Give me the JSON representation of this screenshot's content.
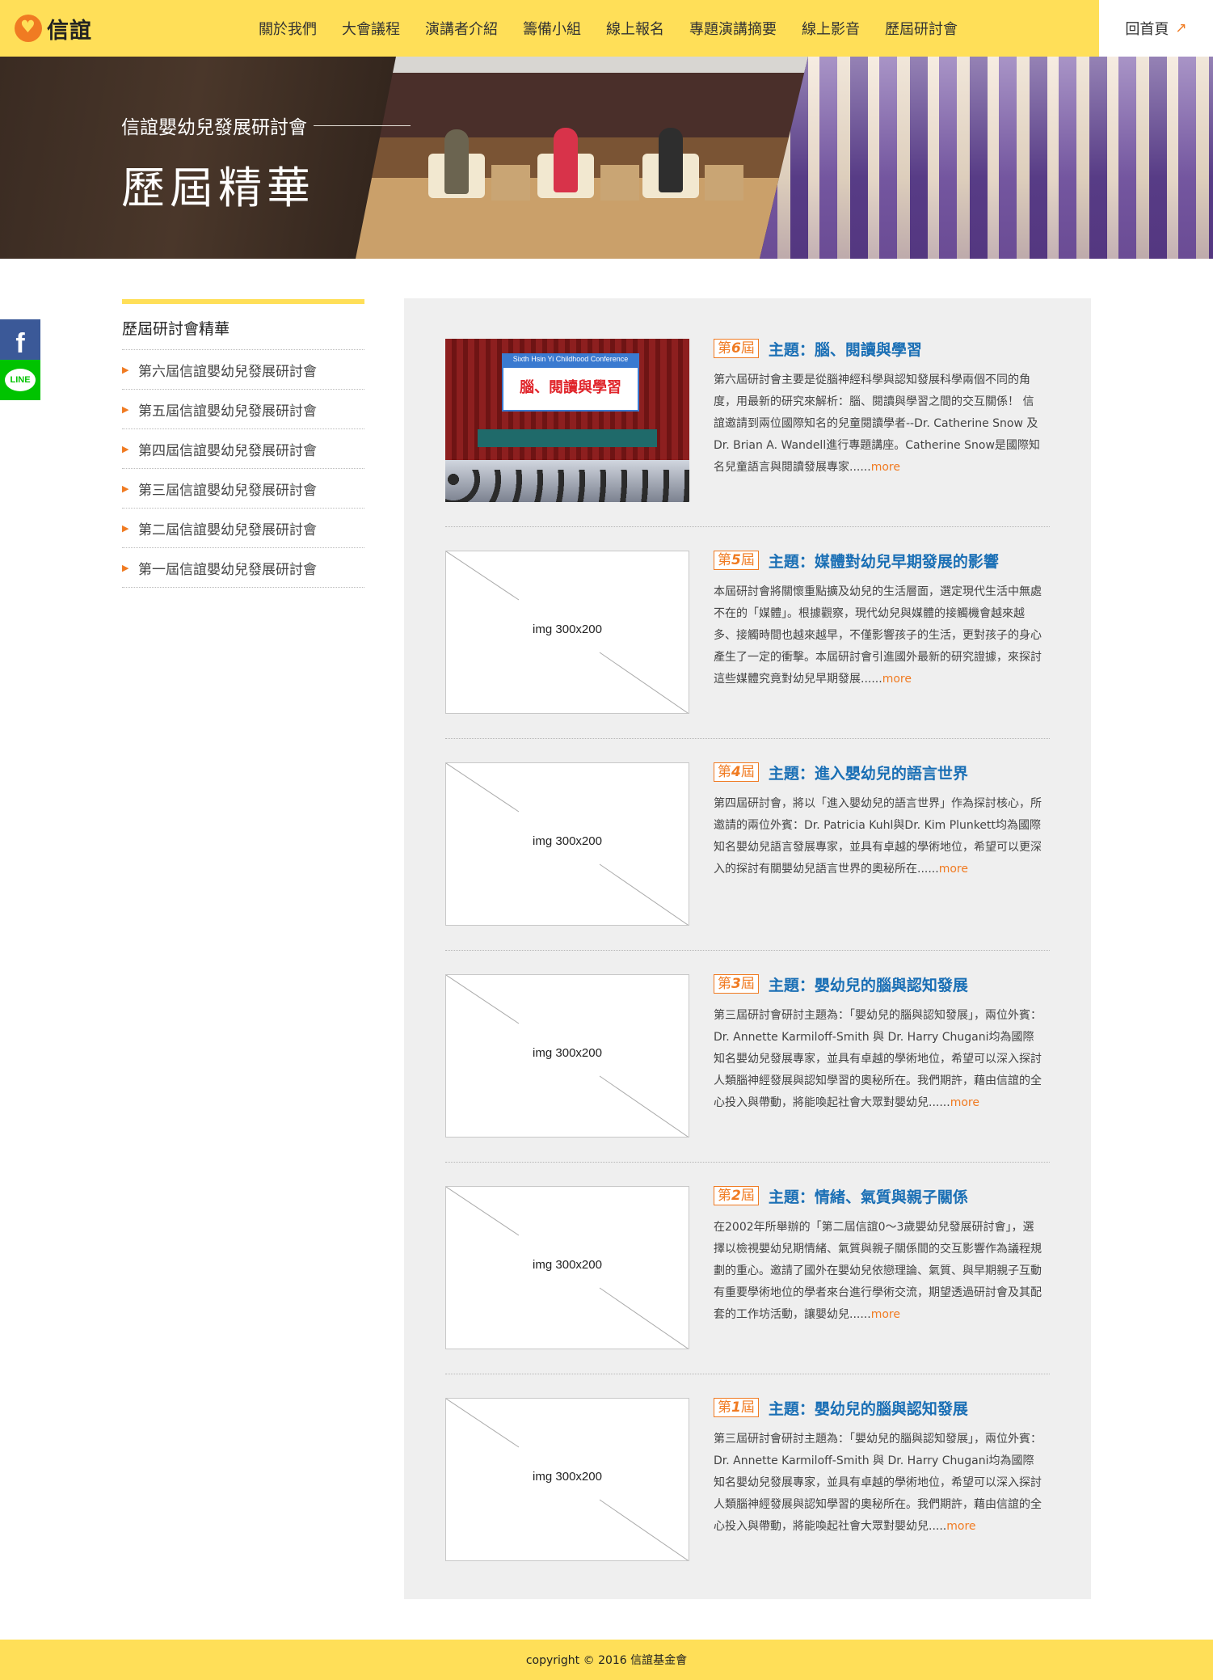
{
  "brand": {
    "name": "信誼"
  },
  "nav": {
    "items": [
      "關於我們",
      "大會議程",
      "演講者介紹",
      "籌備小組",
      "線上報名",
      "專題演講摘要",
      "線上影音",
      "歷屆研討會"
    ],
    "home_label": "回首頁",
    "home_icon": "arrow-up-right-icon"
  },
  "banner": {
    "subtitle": "信誼嬰幼兒發展研討會",
    "title": "歷屆精華"
  },
  "social": {
    "facebook": "f",
    "line": "LINE"
  },
  "sidebar": {
    "title": "歷屆研討會精華",
    "items": [
      "第六屆信誼嬰幼兒發展研討會",
      "第五屆信誼嬰幼兒發展研討會",
      "第四屆信誼嬰幼兒發展研討會",
      "第三屆信誼嬰幼兒發展研討會",
      "第二屆信誼嬰幼兒發展研討會",
      "第一屆信誼嬰幼兒發展研討會"
    ]
  },
  "entries": [
    {
      "ed_prefix": "第",
      "ed_num": "6",
      "ed_suffix": "屆",
      "title": "主題：腦、閱讀與學習",
      "text": "第六屆研討會主要是從腦神經科學與認知發展科學兩個不同的角度，用最新的研究來解析：腦、閱讀與學習之間的交互關係！ 信誼邀請到兩位國際知名的兒童閱讀學者--Dr. Catherine Snow 及 Dr. Brian A. Wandell進行專題講座。Catherine Snow是國際知名兒童語言與閱讀發展專家......",
      "more": "more",
      "photo": true,
      "photo_screen_top": "Sixth Hsin Yi Childhood Conference",
      "photo_screen_text": "腦、閱讀與學習"
    },
    {
      "ed_prefix": "第",
      "ed_num": "5",
      "ed_suffix": "屆",
      "title": "主題：媒體對幼兒早期發展的影響",
      "text": "本屆研討會將關懷重點擴及幼兒的生活層面，選定現代生活中無處不在的「媒體」。根據觀察，現代幼兒與媒體的接觸機會越來越多、接觸時間也越來越早，不僅影響孩子的生活，更對孩子的身心產生了一定的衝擊。本屆研討會引進國外最新的研究證據，來探討這些媒體究竟對幼兒早期發展......",
      "more": "more",
      "placeholder": "img 300x200"
    },
    {
      "ed_prefix": "第",
      "ed_num": "4",
      "ed_suffix": "屆",
      "title": "主題：進入嬰幼兒的語言世界",
      "text": "第四屆研討會，將以「進入嬰幼兒的語言世界」作為探討核心，所邀請的兩位外賓：Dr. Patricia Kuhl與Dr. Kim Plunkett均為國際知名嬰幼兒語言發展專家，並具有卓越的學術地位，希望可以更深入的探討有關嬰幼兒語言世界的奧秘所在......",
      "more": "more",
      "placeholder": "img 300x200"
    },
    {
      "ed_prefix": "第",
      "ed_num": "3",
      "ed_suffix": "屆",
      "title": "主題：嬰幼兒的腦與認知發展",
      "text": "第三屆研討會研討主題為：「嬰幼兒的腦與認知發展」，兩位外賓：Dr. Annette Karmiloff-Smith 與 Dr. Harry Chugani均為國際知名嬰幼兒發展專家，並具有卓越的學術地位，希望可以深入探討人類腦神經發展與認知學習的奧秘所在。我們期許，藉由信誼的全心投入與帶動，將能喚起社會大眾對嬰幼兒......",
      "more": "more",
      "placeholder": "img 300x200"
    },
    {
      "ed_prefix": "第",
      "ed_num": "2",
      "ed_suffix": "屆",
      "title": "主題：情緒、氣質與親子關係",
      "text": "在2002年所舉辦的「第二屆信誼0～3歲嬰幼兒發展研討會」，選擇以檢視嬰幼兒期情緒、氣質與親子關係間的交互影響作為議程規劃的重心。邀請了國外在嬰幼兒依戀理論、氣質、與早期親子互動有重要學術地位的學者來台進行學術交流，期望透過研討會及其配套的工作坊活動，讓嬰幼兒......",
      "more": "more",
      "placeholder": "img 300x200"
    },
    {
      "ed_prefix": "第",
      "ed_num": "1",
      "ed_suffix": "屆",
      "title": "主題：嬰幼兒的腦與認知發展",
      "text": "第三屆研討會研討主題為：「嬰幼兒的腦與認知發展」，兩位外賓：Dr. Annette Karmiloff-Smith 與 Dr. Harry Chugani均為國際知名嬰幼兒發展專家，並具有卓越的學術地位，希望可以深入探討人類腦神經發展與認知學習的奧秘所在。我們期許，藉由信誼的全心投入與帶動，將能喚起社會大眾對嬰幼兒.....",
      "more": "more",
      "placeholder": "img 300x200"
    }
  ],
  "footer": {
    "copyright": "copyright © 2016 信誼基金會"
  },
  "colors": {
    "brand_yellow": "#ffdf58",
    "accent_orange": "#f07b22",
    "title_blue": "#1a6fb5"
  }
}
